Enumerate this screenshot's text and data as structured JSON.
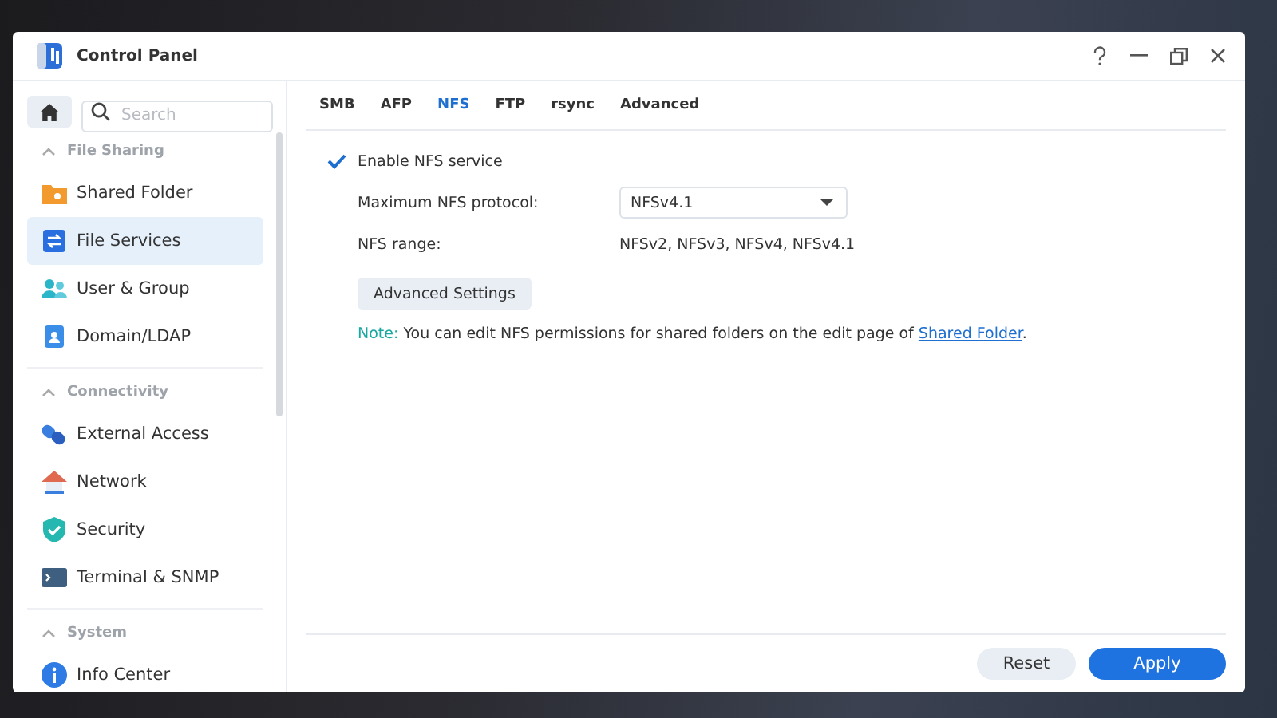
{
  "window": {
    "title": "Control Panel"
  },
  "sidebar": {
    "search": {
      "placeholder": "Search"
    },
    "sections": [
      {
        "title": "File Sharing",
        "expanded": true,
        "items": [
          {
            "label": "Shared Folder",
            "kind": "folder",
            "selected": false
          },
          {
            "label": "File Services",
            "kind": "services",
            "selected": true
          },
          {
            "label": "User & Group",
            "kind": "users",
            "selected": false
          },
          {
            "label": "Domain/LDAP",
            "kind": "domain",
            "selected": false
          }
        ]
      },
      {
        "title": "Connectivity",
        "expanded": true,
        "items": [
          {
            "label": "External Access",
            "kind": "link",
            "selected": false
          },
          {
            "label": "Network",
            "kind": "house",
            "selected": false
          },
          {
            "label": "Security",
            "kind": "shield",
            "selected": false
          },
          {
            "label": "Terminal & SNMP",
            "kind": "terminal",
            "selected": false
          }
        ]
      },
      {
        "title": "System",
        "expanded": true,
        "items": [
          {
            "label": "Info Center",
            "kind": "info",
            "selected": false
          }
        ]
      }
    ]
  },
  "tabs": [
    {
      "label": "SMB",
      "selected": false
    },
    {
      "label": "AFP",
      "selected": false
    },
    {
      "label": "NFS",
      "selected": true
    },
    {
      "label": "FTP",
      "selected": false
    },
    {
      "label": "rsync",
      "selected": false
    },
    {
      "label": "Advanced",
      "selected": false
    }
  ],
  "enable": {
    "label": "Enable NFS service",
    "checked": true
  },
  "protocol": {
    "label": "Maximum NFS protocol:",
    "value": "NFSv4.1"
  },
  "range": {
    "label": "NFS range:",
    "value": "NFSv2, NFSv3, NFSv4, NFSv4.1"
  },
  "advanced_button": "Advanced Settings",
  "note": {
    "label": "Note:",
    "text": " You can edit NFS permissions for shared folders on the edit page of ",
    "link": "Shared Folder",
    "end": "."
  },
  "buttons": {
    "reset": "Reset",
    "apply": "Apply"
  }
}
